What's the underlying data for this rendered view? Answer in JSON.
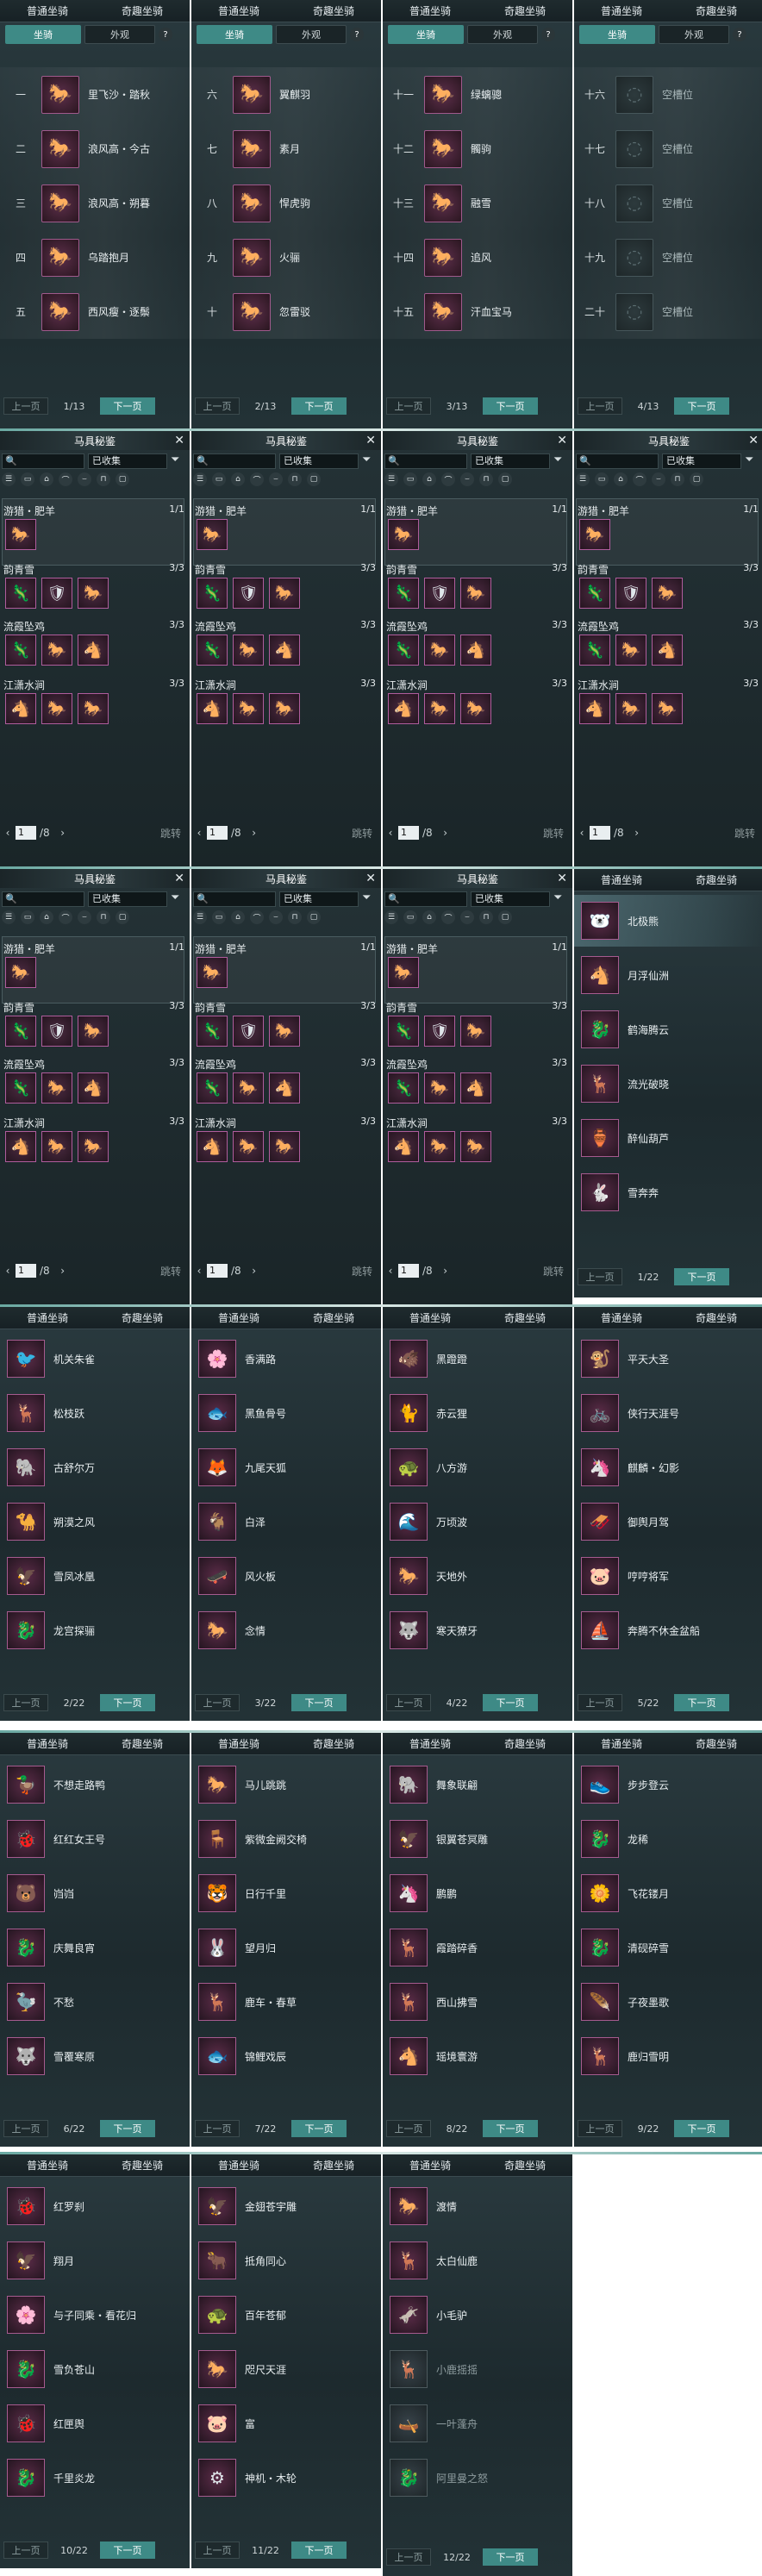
{
  "tabs": {
    "normal": "普通坐骑",
    "fun": "奇趣坐骑",
    "mount": "坐骑",
    "appearance": "外观",
    "help": "?"
  },
  "pager": {
    "prev": "上一页",
    "next": "下一页"
  },
  "mount_pages": [
    {
      "page": "1/13",
      "items": [
        {
          "no": "一",
          "name": "里飞沙・踏秋",
          "icon": "🐎"
        },
        {
          "no": "二",
          "name": "浪风高・今古",
          "icon": "🐎"
        },
        {
          "no": "三",
          "name": "浪风高・朔暮",
          "icon": "🐎"
        },
        {
          "no": "四",
          "name": "乌踏抱月",
          "icon": "🐎"
        },
        {
          "no": "五",
          "name": "西风瘦・逐鬃",
          "icon": "🐎"
        }
      ]
    },
    {
      "page": "2/13",
      "items": [
        {
          "no": "六",
          "name": "翼麒羽",
          "icon": "🐎"
        },
        {
          "no": "七",
          "name": "素月",
          "icon": "🐎"
        },
        {
          "no": "八",
          "name": "悍虎驹",
          "icon": "🐎"
        },
        {
          "no": "九",
          "name": "火骊",
          "icon": "🐎"
        },
        {
          "no": "十",
          "name": "忽雷驳",
          "icon": "🐎"
        }
      ]
    },
    {
      "page": "3/13",
      "items": [
        {
          "no": "十一",
          "name": "绿螭骢",
          "icon": "🐎"
        },
        {
          "no": "十二",
          "name": "髑驹",
          "icon": "🐎"
        },
        {
          "no": "十三",
          "name": "融雪",
          "icon": "🐎"
        },
        {
          "no": "十四",
          "name": "追风",
          "icon": "🐎"
        },
        {
          "no": "十五",
          "name": "汗血宝马",
          "icon": "🐎"
        }
      ]
    },
    {
      "page": "4/13",
      "items": [
        {
          "no": "十六",
          "name": "空槽位",
          "icon": "",
          "empty": true
        },
        {
          "no": "十七",
          "name": "空槽位",
          "icon": "",
          "empty": true
        },
        {
          "no": "十八",
          "name": "空槽位",
          "icon": "",
          "empty": true
        },
        {
          "no": "十九",
          "name": "空槽位",
          "icon": "",
          "empty": true
        },
        {
          "no": "二十",
          "name": "空槽位",
          "icon": "",
          "empty": true
        }
      ]
    }
  ],
  "book": {
    "title": "马具秘鉴",
    "close": "✕",
    "search_placeholder": "",
    "filter": "已收集",
    "jump": "跳转",
    "total": "/8",
    "sections": [
      {
        "name": "游猎・肥羊",
        "count": "1/1",
        "icons": [
          "🐎"
        ]
      },
      {
        "name": "韵青雪",
        "count": "3/3",
        "icons": [
          "🦎",
          "🛡",
          "🐎"
        ]
      },
      {
        "name": "流霞坠鸡",
        "count": "3/3",
        "icons": [
          "🦎",
          "🐎",
          "🐴"
        ]
      },
      {
        "name": "江潇水涧",
        "count": "3/3",
        "icons": [
          "🐴",
          "🐎",
          "🐎"
        ]
      }
    ],
    "pages": [
      "1",
      "1",
      "1",
      "1",
      "1",
      "1",
      "1"
    ]
  },
  "fun_pages": [
    {
      "page": "1/22",
      "items": [
        {
          "name": "北极熊",
          "icon": "🐻‍❄️"
        },
        {
          "name": "月浮仙洲",
          "icon": "🐴"
        },
        {
          "name": "鹤海腾云",
          "icon": "🐉"
        },
        {
          "name": "流光破晓",
          "icon": "🦌"
        },
        {
          "name": "醉仙葫芦",
          "icon": "🏺"
        },
        {
          "name": "雪奔奔",
          "icon": "🐇"
        }
      ]
    },
    {
      "page": "2/22",
      "items": [
        {
          "name": "机关朱雀",
          "icon": "🐦"
        },
        {
          "name": "松枝跃",
          "icon": "🦌"
        },
        {
          "name": "古舒尔万",
          "icon": "🐘"
        },
        {
          "name": "朔漠之风",
          "icon": "🐪"
        },
        {
          "name": "雪凤冰凰",
          "icon": "🦅"
        },
        {
          "name": "龙宫探骊",
          "icon": "🐉"
        }
      ]
    },
    {
      "page": "3/22",
      "items": [
        {
          "name": "香满路",
          "icon": "🌸"
        },
        {
          "name": "黑鱼骨号",
          "icon": "🐟"
        },
        {
          "name": "九尾天狐",
          "icon": "🦊"
        },
        {
          "name": "白泽",
          "icon": "🐐"
        },
        {
          "name": "风火板",
          "icon": "🛹"
        },
        {
          "name": "念情",
          "icon": "🐎"
        }
      ]
    },
    {
      "page": "4/22",
      "items": [
        {
          "name": "黑蹬蹬",
          "icon": "🐗"
        },
        {
          "name": "赤云狸",
          "icon": "🐈"
        },
        {
          "name": "八方游",
          "icon": "🐢"
        },
        {
          "name": "万顷波",
          "icon": "🌊"
        },
        {
          "name": "天地外",
          "icon": "🐎"
        },
        {
          "name": "寒天獠牙",
          "icon": "🐺"
        }
      ]
    },
    {
      "page": "5/22",
      "items": [
        {
          "name": "平天大圣",
          "icon": "🐒"
        },
        {
          "name": "侠行天涯号",
          "icon": "🚲"
        },
        {
          "name": "麒麟・幻影",
          "icon": "🦄"
        },
        {
          "name": "御舆月驾",
          "icon": "🛷"
        },
        {
          "name": "哼哼将军",
          "icon": "🐷"
        },
        {
          "name": "奔腾不休金盆船",
          "icon": "⛵"
        }
      ]
    },
    {
      "page": "6/22",
      "items": [
        {
          "name": "不想走路鸭",
          "icon": "🦆"
        },
        {
          "name": "红红女王号",
          "icon": "🐞"
        },
        {
          "name": "岿岿",
          "icon": "🐻"
        },
        {
          "name": "庆舞良宵",
          "icon": "🐉"
        },
        {
          "name": "不愁",
          "icon": "🦤"
        },
        {
          "name": "雪覆寒原",
          "icon": "🐺"
        }
      ]
    },
    {
      "page": "7/22",
      "items": [
        {
          "name": "马儿跳跳",
          "icon": "🐎"
        },
        {
          "name": "紫微金阙交椅",
          "icon": "🪑"
        },
        {
          "name": "日行千里",
          "icon": "🐯"
        },
        {
          "name": "望月归",
          "icon": "🐰"
        },
        {
          "name": "鹿车・春草",
          "icon": "🦌"
        },
        {
          "name": "锦鲤戏辰",
          "icon": "🐟"
        }
      ]
    },
    {
      "page": "8/22",
      "items": [
        {
          "name": "舞象联翩",
          "icon": "🐘"
        },
        {
          "name": "银翼苍冥雕",
          "icon": "🦅"
        },
        {
          "name": "鹏鹏",
          "icon": "🦄"
        },
        {
          "name": "霞踏碎香",
          "icon": "🦌"
        },
        {
          "name": "西山拂雪",
          "icon": "🦌"
        },
        {
          "name": "瑶境寰游",
          "icon": "🐴"
        }
      ]
    },
    {
      "page": "9/22",
      "items": [
        {
          "name": "步步登云",
          "icon": "👟"
        },
        {
          "name": "龙稀",
          "icon": "🐉"
        },
        {
          "name": "飞花镂月",
          "icon": "🌼"
        },
        {
          "name": "清砚碎雪",
          "icon": "🐉"
        },
        {
          "name": "子夜墨歌",
          "icon": "🪶"
        },
        {
          "name": "鹿归雪明",
          "icon": "🦌"
        }
      ]
    },
    {
      "page": "10/22",
      "items": [
        {
          "name": "红罗刹",
          "icon": "🐞"
        },
        {
          "name": "翔月",
          "icon": "🦅"
        },
        {
          "name": "与子同乘・看花归",
          "icon": "🌸"
        },
        {
          "name": "雪负苍山",
          "icon": "🐉"
        },
        {
          "name": "红匣舆",
          "icon": "🐞"
        },
        {
          "name": "千里炎龙",
          "icon": "🐉"
        }
      ]
    },
    {
      "page": "11/22",
      "items": [
        {
          "name": "金翅苍宇雕",
          "icon": "🦅"
        },
        {
          "name": "抵角同心",
          "icon": "🐂"
        },
        {
          "name": "百年苍郁",
          "icon": "🐢"
        },
        {
          "name": "咫尺天涯",
          "icon": "🐎"
        },
        {
          "name": "富",
          "icon": "🐷"
        },
        {
          "name": "神机・木轮",
          "icon": "⚙"
        }
      ]
    },
    {
      "page": "12/22",
      "items": [
        {
          "name": "渡情",
          "icon": "🐎"
        },
        {
          "name": "太白仙鹿",
          "icon": "🦌"
        },
        {
          "name": "小毛驴",
          "icon": "🫏",
          "dim": false
        },
        {
          "name": "小鹿摇摇",
          "icon": "🦌",
          "dim": true
        },
        {
          "name": "一叶蓬舟",
          "icon": "🛶",
          "dim": true
        },
        {
          "name": "阿里曼之怒",
          "icon": "🐉",
          "dim": true
        }
      ]
    }
  ],
  "colors": {
    "accent": "#3e8a86",
    "frame": "#a05a8c",
    "panel": "#233236"
  }
}
